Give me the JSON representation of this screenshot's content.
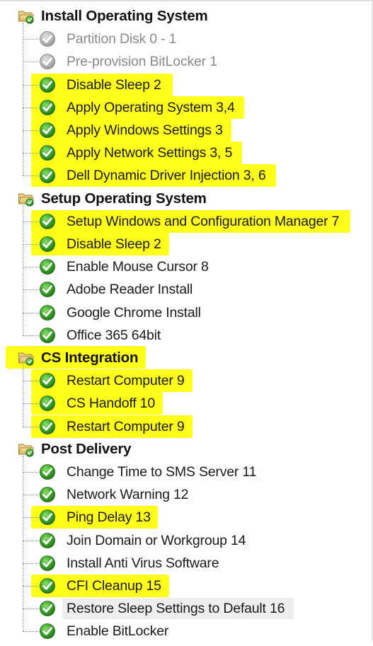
{
  "tree": {
    "groups": [
      {
        "name": "Install Operating System",
        "items": [
          {
            "label": "Partition Disk 0 - 1",
            "status": "disabled"
          },
          {
            "label": "Pre-provision BitLocker  1",
            "status": "disabled"
          },
          {
            "label": "Disable Sleep  2",
            "status": "success",
            "highlighted": true
          },
          {
            "label": "Apply Operating System 3,4",
            "status": "success",
            "highlighted": true
          },
          {
            "label": "Apply Windows Settings 3",
            "status": "success",
            "highlighted": true
          },
          {
            "label": "Apply Network Settings 3, 5",
            "status": "success",
            "highlighted": true
          },
          {
            "label": "Dell Dynamic Driver Injection 3, 6",
            "status": "success",
            "highlighted": true
          }
        ]
      },
      {
        "name": "Setup Operating System",
        "items": [
          {
            "label": "Setup Windows and Configuration Manager 7",
            "status": "success",
            "highlighted": true
          },
          {
            "label": "Disable Sleep 2",
            "status": "success",
            "highlighted": true
          },
          {
            "label": "Enable Mouse Cursor 8",
            "status": "success"
          },
          {
            "label": "Adobe Reader Install",
            "status": "success"
          },
          {
            "label": "Google Chrome Install",
            "status": "success"
          },
          {
            "label": "Office 365 64bit",
            "status": "success"
          }
        ]
      },
      {
        "name": "CS Integration",
        "highlighted": true,
        "items": [
          {
            "label": "Restart Computer 9",
            "status": "success",
            "highlighted": true
          },
          {
            "label": "CS Handoff 10",
            "status": "success",
            "highlighted": true
          },
          {
            "label": "Restart Computer 9",
            "status": "success",
            "highlighted": true
          }
        ]
      },
      {
        "name": "Post Delivery",
        "items": [
          {
            "label": "Change Time to SMS Server 11",
            "status": "success"
          },
          {
            "label": "Network Warning 12",
            "status": "success"
          },
          {
            "label": "Ping Delay 13",
            "status": "success",
            "highlighted": true
          },
          {
            "label": "Join Domain or Workgroup 14",
            "status": "success"
          },
          {
            "label": "Install Anti Virus Software",
            "status": "success"
          },
          {
            "label": "CFI Cleanup 15",
            "status": "success",
            "highlighted": true
          },
          {
            "label": "Restore Sleep Settings to Default 16",
            "status": "success",
            "selected": true
          },
          {
            "label": "Enable BitLocker",
            "status": "success"
          }
        ]
      }
    ]
  },
  "colors": {
    "highlight": "#ffff19",
    "success_green": "#3aa52a",
    "disabled_gray": "#a8a8a8",
    "folder_tan": "#e7c87a"
  },
  "icons": {
    "group": "folder-check-icon",
    "success": "green-check-icon",
    "disabled": "gray-check-icon"
  }
}
